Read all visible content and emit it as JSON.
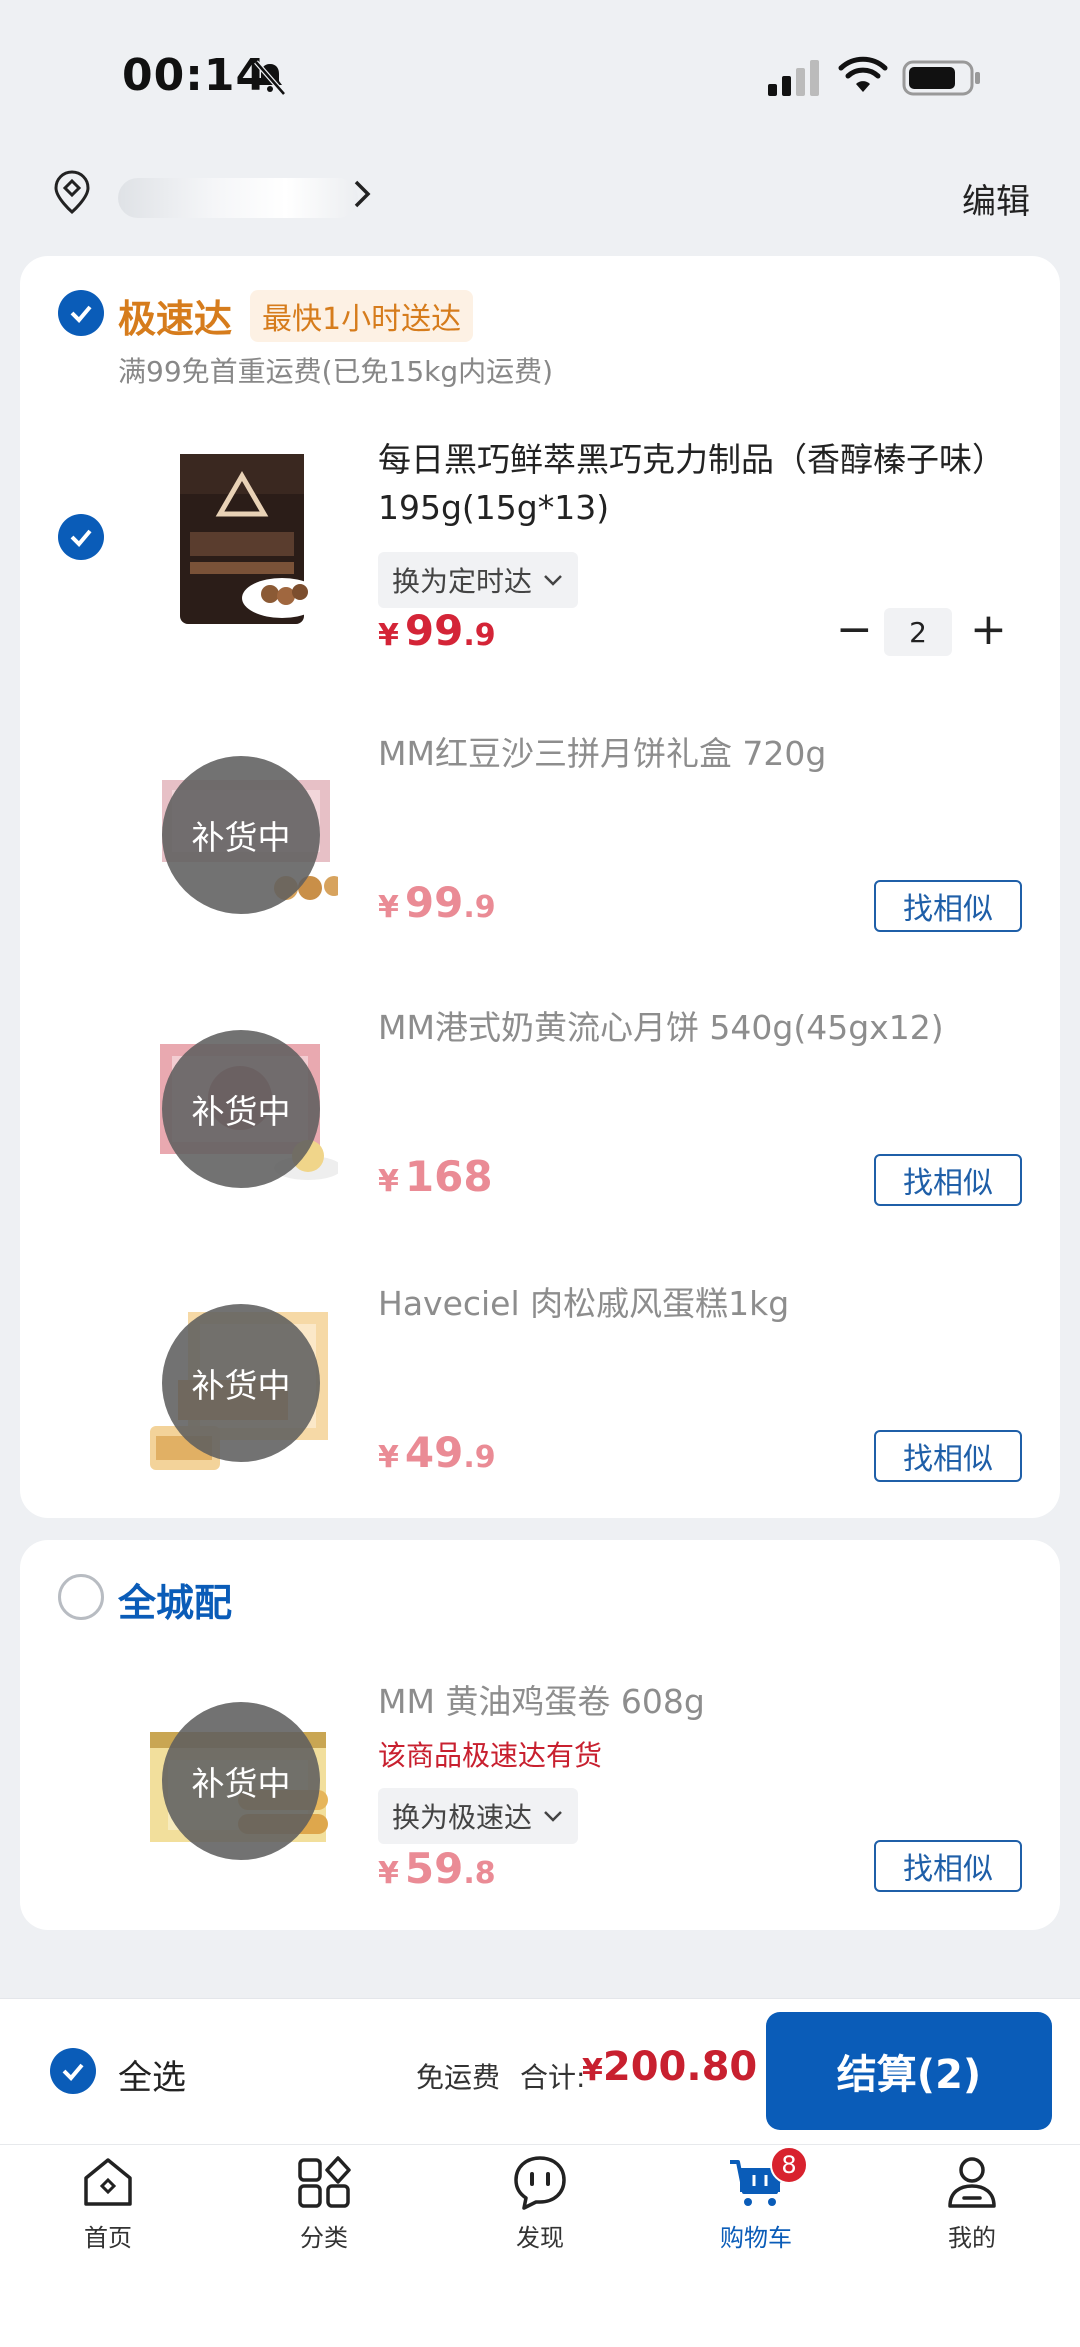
{
  "status_bar": {
    "time": "00:14"
  },
  "header": {
    "edit_label": "编辑"
  },
  "express": {
    "title": "极速达",
    "badge": "最快1小时送达",
    "note": "满99免首重运费(已免15kg内运费)",
    "items": [
      {
        "name": "每日黑巧鲜萃黑巧克力制品（香醇榛子味） 195g(15g*13)",
        "switch_label": "换为定时达",
        "price_int": "99",
        "price_dec": ".9",
        "qty": "2"
      },
      {
        "name": "MM红豆沙三拼月饼礼盒 720g",
        "restock": "补货中",
        "price_int": "99",
        "price_dec": ".9",
        "find_label": "找相似"
      },
      {
        "name": "MM港式奶黄流心月饼 540g(45gx12)",
        "restock": "补货中",
        "price_int": "168",
        "price_dec": "",
        "find_label": "找相似"
      },
      {
        "name": "Haveciel 肉松戚风蛋糕1kg",
        "restock": "补货中",
        "price_int": "49",
        "price_dec": ".9",
        "find_label": "找相似"
      }
    ]
  },
  "citywide": {
    "title": "全城配",
    "items": [
      {
        "name": "MM 黄油鸡蛋卷 608g",
        "stock_note": "该商品极速达有货",
        "switch_label": "换为极速达",
        "restock": "补货中",
        "price_int": "59",
        "price_dec": ".8",
        "find_label": "找相似"
      }
    ]
  },
  "currency_symbol": "¥",
  "checkout": {
    "select_all": "全选",
    "free_ship": "免运费",
    "total_label": "合计:",
    "total_symbol": "¥",
    "total_value": "200.80",
    "pay_label": "结算(2)"
  },
  "tabbar": {
    "tabs": [
      {
        "label": "首页",
        "icon": "home-icon"
      },
      {
        "label": "分类",
        "icon": "category-icon"
      },
      {
        "label": "发现",
        "icon": "discover-icon"
      },
      {
        "label": "购物车",
        "icon": "cart-icon",
        "badge": "8"
      },
      {
        "label": "我的",
        "icon": "profile-icon"
      }
    ]
  },
  "colors": {
    "accent": "#0a5cb8",
    "price": "#d42437",
    "orange": "#d67c1c"
  }
}
